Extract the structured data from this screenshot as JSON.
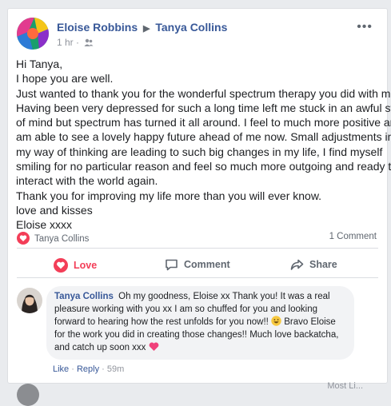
{
  "post": {
    "author": "Eloise Robbins",
    "recipient": "Tanya Collins",
    "time": "1 hr",
    "more_label": "•••",
    "body_lines": [
      "Hi Tanya,",
      "I hope you are well.",
      "Just wanted to thank you for the wonderful spectrum therapy you did with me.",
      "Having been very depressed for such a long time left me stuck in an awful state",
      "of mind but spectrum has turned it all around. I feel to much more positive and",
      "am able to see a lovely happy future ahead of me now. Small adjustments in",
      "my way of thinking are leading to such big changes in my life, I find myself",
      "smiling for no particular reason and feel so much more outgoing and ready to",
      "interact with the world again.",
      "Thank you for improving my life more than you will ever know.",
      "love and kisses",
      "Eloise xxxx"
    ]
  },
  "reactions": {
    "reactor_name": "Tanya Collins",
    "comment_count": "1 Comment"
  },
  "actions": {
    "love": "Love",
    "comment": "Comment",
    "share": "Share"
  },
  "comment": {
    "author": "Tanya Collins",
    "line1": "Oh my goodness, Eloise xx Thank you! It was a real",
    "line2": "pleasure working with you xx I am so chuffed for you and looking",
    "line3": "forward to hearing how the rest unfolds for you now!!",
    "line3b": "Bravo Eloise",
    "line4": "for the work you did in creating those changes!! Much love backatcha,",
    "line5": "and catch up soon xxx",
    "like": "Like",
    "sep": " · ",
    "reply": "Reply",
    "time": "59m"
  },
  "partial_row": {
    "text": "Most Li..."
  },
  "colors": {
    "link": "#385898",
    "love": "#f33e58",
    "muted": "#606770",
    "bubble": "#f2f3f5"
  }
}
